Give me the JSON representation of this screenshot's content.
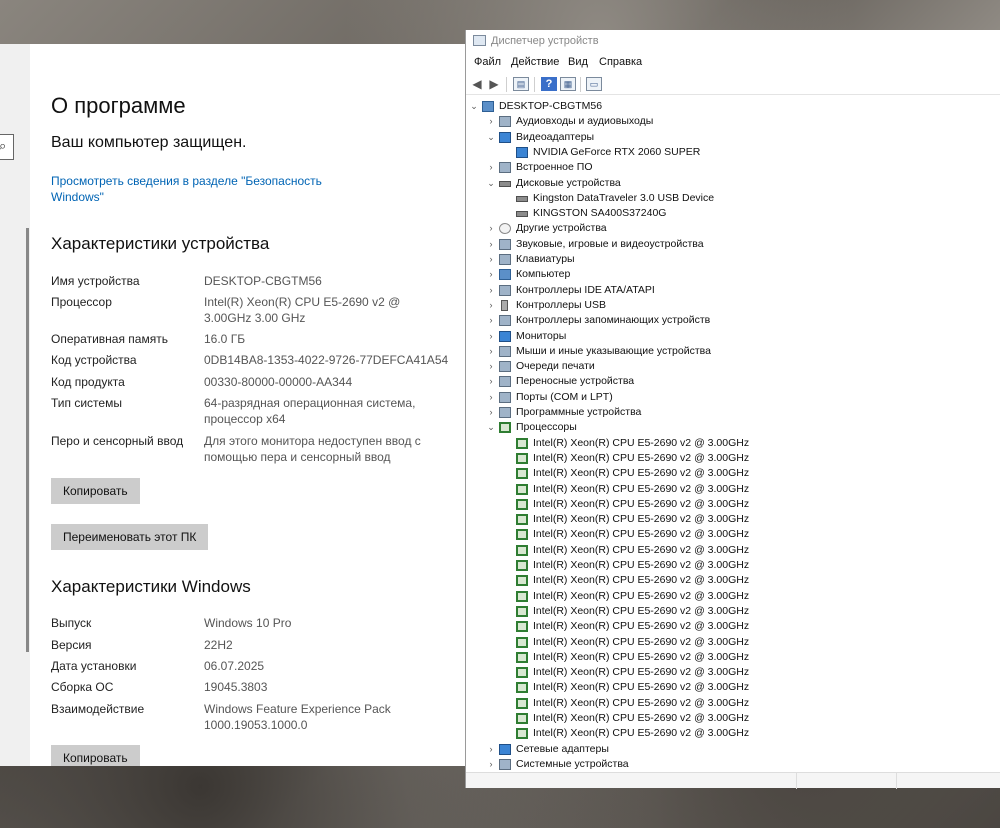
{
  "about": {
    "title": "О программе",
    "protected": "Ваш компьютер защищен.",
    "link": "Просмотреть сведения в разделе \"Безопасность Windows\"",
    "device_spec_heading": "Характеристики устройства",
    "device_specs": [
      {
        "k": "Имя устройства",
        "v": "DESKTOP-CBGTM56"
      },
      {
        "k": "Процессор",
        "v": "Intel(R) Xeon(R) CPU E5-2690 v2 @ 3.00GHz   3.00 GHz"
      },
      {
        "k": "Оперативная память",
        "v": "16.0 ГБ"
      },
      {
        "k": "Код устройства",
        "v": "0DB14BA8-1353-4022-9726-77DEFCA41A54"
      },
      {
        "k": "Код продукта",
        "v": "00330-80000-00000-AA344"
      },
      {
        "k": "Тип системы",
        "v": "64-разрядная операционная система, процессор x64"
      },
      {
        "k": "Перо и сенсорный ввод",
        "v": "Для этого монитора недоступен ввод с помощью пера и сенсорный ввод"
      }
    ],
    "copy_button": "Копировать",
    "rename_button": "Переименовать этот ПК",
    "windows_spec_heading": "Характеристики Windows",
    "windows_specs": [
      {
        "k": "Выпуск",
        "v": "Windows 10 Pro"
      },
      {
        "k": "Версия",
        "v": "22H2"
      },
      {
        "k": "Дата установки",
        "v": "06.07.2025"
      },
      {
        "k": "Сборка ОС",
        "v": "19045.3803"
      },
      {
        "k": "Взаимодействие",
        "v": "Windows Feature Experience Pack 1000.19053.1000.0"
      }
    ],
    "copy_button_2": "Копировать"
  },
  "devmgr": {
    "title": "Диспетчер устройств",
    "menu": [
      "Файл",
      "Действие",
      "Вид",
      "Справка"
    ],
    "toolbar_icons": [
      "back-arrow-icon",
      "forward-arrow-icon",
      "properties-icon",
      "help-icon",
      "update-driver-icon",
      "monitor-scan-icon"
    ],
    "tree": [
      {
        "label": "DESKTOP-CBGTM56",
        "level": 0,
        "expanded": true,
        "icon": "computer-icon"
      },
      {
        "label": "Аудиовходы и аудиовыходы",
        "level": 1,
        "expanded": false,
        "icon": "speaker-icon"
      },
      {
        "label": "Видеоадаптеры",
        "level": 1,
        "expanded": true,
        "icon": "display-adapter-icon"
      },
      {
        "label": "NVIDIA GeForce RTX 2060 SUPER",
        "level": 2,
        "icon": "display-adapter-icon"
      },
      {
        "label": "Встроенное ПО",
        "level": 1,
        "expanded": false,
        "icon": "firmware-icon"
      },
      {
        "label": "Дисковые устройства",
        "level": 1,
        "expanded": true,
        "icon": "disk-icon"
      },
      {
        "label": "Kingston DataTraveler 3.0 USB Device",
        "level": 2,
        "icon": "disk-icon"
      },
      {
        "label": "KINGSTON SA400S37240G",
        "level": 2,
        "icon": "disk-icon"
      },
      {
        "label": "Другие устройства",
        "level": 1,
        "expanded": false,
        "icon": "unknown-device-icon"
      },
      {
        "label": "Звуковые, игровые и видеоустройства",
        "level": 1,
        "expanded": false,
        "icon": "sound-icon"
      },
      {
        "label": "Клавиатуры",
        "level": 1,
        "expanded": false,
        "icon": "keyboard-icon"
      },
      {
        "label": "Компьютер",
        "level": 1,
        "expanded": false,
        "icon": "computer-icon"
      },
      {
        "label": "Контроллеры IDE ATA/ATAPI",
        "level": 1,
        "expanded": false,
        "icon": "ide-controller-icon"
      },
      {
        "label": "Контроллеры USB",
        "level": 1,
        "expanded": false,
        "icon": "usb-icon"
      },
      {
        "label": "Контроллеры запоминающих устройств",
        "level": 1,
        "expanded": false,
        "icon": "storage-controller-icon"
      },
      {
        "label": "Мониторы",
        "level": 1,
        "expanded": false,
        "icon": "monitor-icon"
      },
      {
        "label": "Мыши и иные указывающие устройства",
        "level": 1,
        "expanded": false,
        "icon": "mouse-icon"
      },
      {
        "label": "Очереди печати",
        "level": 1,
        "expanded": false,
        "icon": "printer-icon"
      },
      {
        "label": "Переносные устройства",
        "level": 1,
        "expanded": false,
        "icon": "portable-device-icon"
      },
      {
        "label": "Порты (COM и LPT)",
        "level": 1,
        "expanded": false,
        "icon": "port-icon"
      },
      {
        "label": "Программные устройства",
        "level": 1,
        "expanded": false,
        "icon": "software-device-icon"
      },
      {
        "label": "Процессоры",
        "level": 1,
        "expanded": true,
        "icon": "cpu-icon"
      },
      {
        "label": "Intel(R) Xeon(R) CPU E5-2690 v2 @ 3.00GHz",
        "level": 2,
        "icon": "cpu-icon"
      },
      {
        "label": "Intel(R) Xeon(R) CPU E5-2690 v2 @ 3.00GHz",
        "level": 2,
        "icon": "cpu-icon"
      },
      {
        "label": "Intel(R) Xeon(R) CPU E5-2690 v2 @ 3.00GHz",
        "level": 2,
        "icon": "cpu-icon"
      },
      {
        "label": "Intel(R) Xeon(R) CPU E5-2690 v2 @ 3.00GHz",
        "level": 2,
        "icon": "cpu-icon"
      },
      {
        "label": "Intel(R) Xeon(R) CPU E5-2690 v2 @ 3.00GHz",
        "level": 2,
        "icon": "cpu-icon"
      },
      {
        "label": "Intel(R) Xeon(R) CPU E5-2690 v2 @ 3.00GHz",
        "level": 2,
        "icon": "cpu-icon"
      },
      {
        "label": "Intel(R) Xeon(R) CPU E5-2690 v2 @ 3.00GHz",
        "level": 2,
        "icon": "cpu-icon"
      },
      {
        "label": "Intel(R) Xeon(R) CPU E5-2690 v2 @ 3.00GHz",
        "level": 2,
        "icon": "cpu-icon"
      },
      {
        "label": "Intel(R) Xeon(R) CPU E5-2690 v2 @ 3.00GHz",
        "level": 2,
        "icon": "cpu-icon"
      },
      {
        "label": "Intel(R) Xeon(R) CPU E5-2690 v2 @ 3.00GHz",
        "level": 2,
        "icon": "cpu-icon"
      },
      {
        "label": "Intel(R) Xeon(R) CPU E5-2690 v2 @ 3.00GHz",
        "level": 2,
        "icon": "cpu-icon"
      },
      {
        "label": "Intel(R) Xeon(R) CPU E5-2690 v2 @ 3.00GHz",
        "level": 2,
        "icon": "cpu-icon"
      },
      {
        "label": "Intel(R) Xeon(R) CPU E5-2690 v2 @ 3.00GHz",
        "level": 2,
        "icon": "cpu-icon"
      },
      {
        "label": "Intel(R) Xeon(R) CPU E5-2690 v2 @ 3.00GHz",
        "level": 2,
        "icon": "cpu-icon"
      },
      {
        "label": "Intel(R) Xeon(R) CPU E5-2690 v2 @ 3.00GHz",
        "level": 2,
        "icon": "cpu-icon"
      },
      {
        "label": "Intel(R) Xeon(R) CPU E5-2690 v2 @ 3.00GHz",
        "level": 2,
        "icon": "cpu-icon"
      },
      {
        "label": "Intel(R) Xeon(R) CPU E5-2690 v2 @ 3.00GHz",
        "level": 2,
        "icon": "cpu-icon"
      },
      {
        "label": "Intel(R) Xeon(R) CPU E5-2690 v2 @ 3.00GHz",
        "level": 2,
        "icon": "cpu-icon"
      },
      {
        "label": "Intel(R) Xeon(R) CPU E5-2690 v2 @ 3.00GHz",
        "level": 2,
        "icon": "cpu-icon"
      },
      {
        "label": "Intel(R) Xeon(R) CPU E5-2690 v2 @ 3.00GHz",
        "level": 2,
        "icon": "cpu-icon"
      },
      {
        "label": "Сетевые адаптеры",
        "level": 1,
        "expanded": false,
        "icon": "network-adapter-icon"
      },
      {
        "label": "Системные устройства",
        "level": 1,
        "expanded": false,
        "icon": "system-device-icon"
      }
    ]
  }
}
